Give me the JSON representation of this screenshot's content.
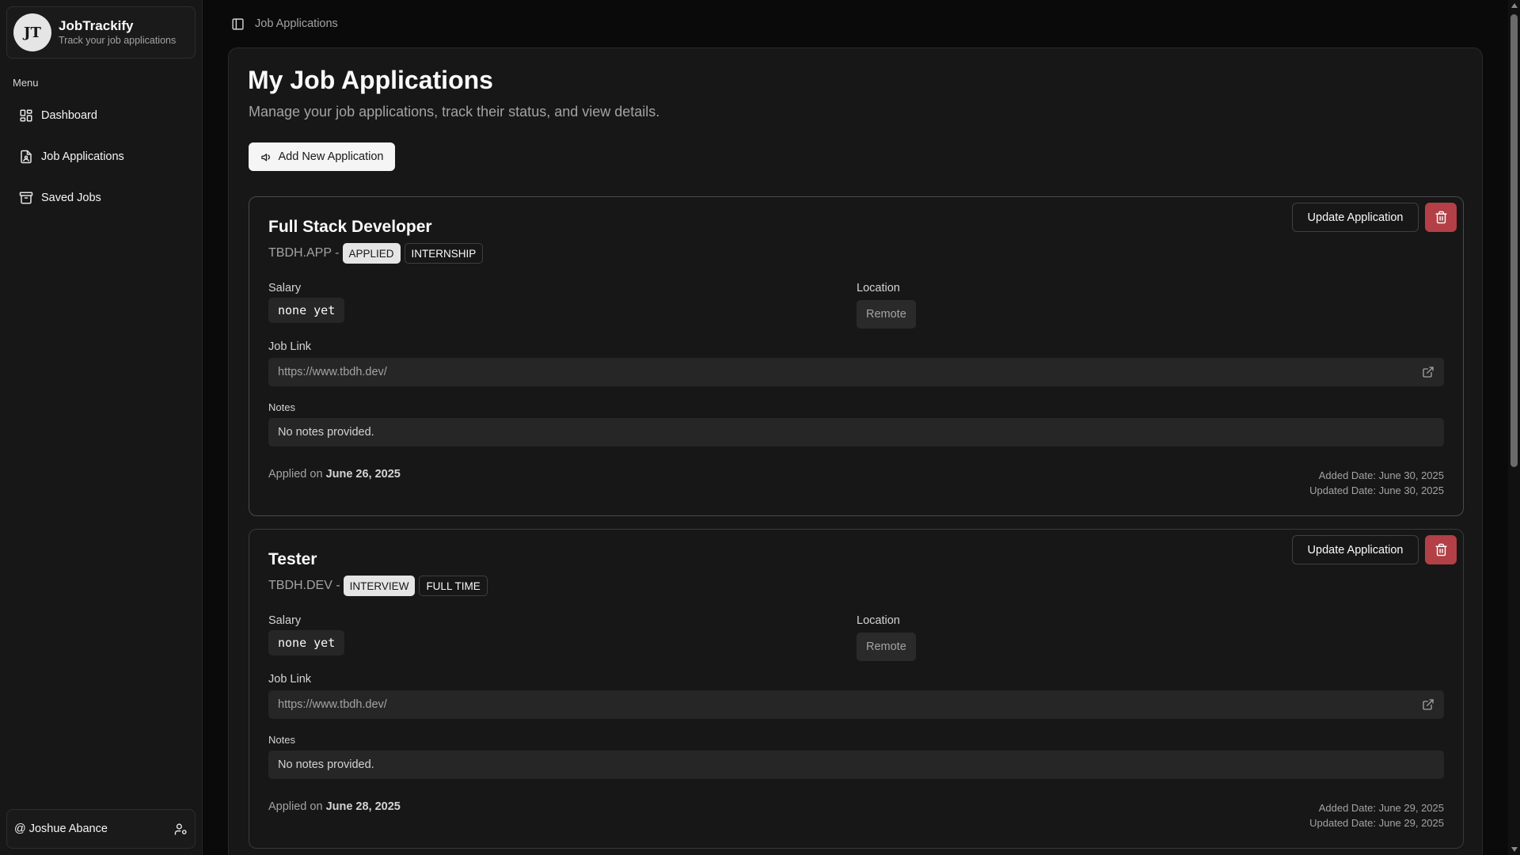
{
  "app": {
    "logo_text": "JT",
    "title": "JobTrackify",
    "subtitle": "Track your job applications"
  },
  "sidebar": {
    "menu_label": "Menu",
    "items": [
      {
        "label": "Dashboard",
        "icon": "dashboard-icon"
      },
      {
        "label": "Job Applications",
        "icon": "file-user-icon"
      },
      {
        "label": "Saved Jobs",
        "icon": "archive-icon"
      }
    ],
    "user": {
      "name": "@ Joshue Abance",
      "icon": "user-cog-icon"
    }
  },
  "topbar": {
    "toggle_icon": "sidebar-toggle-icon",
    "breadcrumb": "Job Applications"
  },
  "page": {
    "title": "My Job Applications",
    "subtitle": "Manage your job applications, track their status, and view details.",
    "add_button": "Add New Application"
  },
  "labels": {
    "salary": "Salary",
    "location": "Location",
    "job_link": "Job Link",
    "notes": "Notes",
    "applied_on": "Applied on",
    "update_button": "Update Application"
  },
  "applications": [
    {
      "title": "Full Stack Developer",
      "company": "TBDH.APP -",
      "status": "APPLIED",
      "type": "INTERNSHIP",
      "salary": "none yet",
      "location": "Remote",
      "job_link": "https://www.tbdh.dev/",
      "notes": "No notes provided.",
      "applied_date": "June 26, 2025",
      "added_date": "Added Date: June 30, 2025",
      "updated_date": "Updated Date: June 30, 2025"
    },
    {
      "title": "Tester",
      "company": "TBDH.DEV -",
      "status": "INTERVIEW",
      "type": "FULL TIME",
      "salary": "none yet",
      "location": "Remote",
      "job_link": "https://www.tbdh.dev/",
      "notes": "No notes provided.",
      "applied_date": "June 28, 2025",
      "added_date": "Added Date: June 29, 2025",
      "updated_date": "Updated Date: June 29, 2025"
    }
  ],
  "colors": {
    "background": "#0a0a0a",
    "panel": "#171717",
    "delete": "#b24046",
    "badge_status": "#e5e5e5"
  }
}
